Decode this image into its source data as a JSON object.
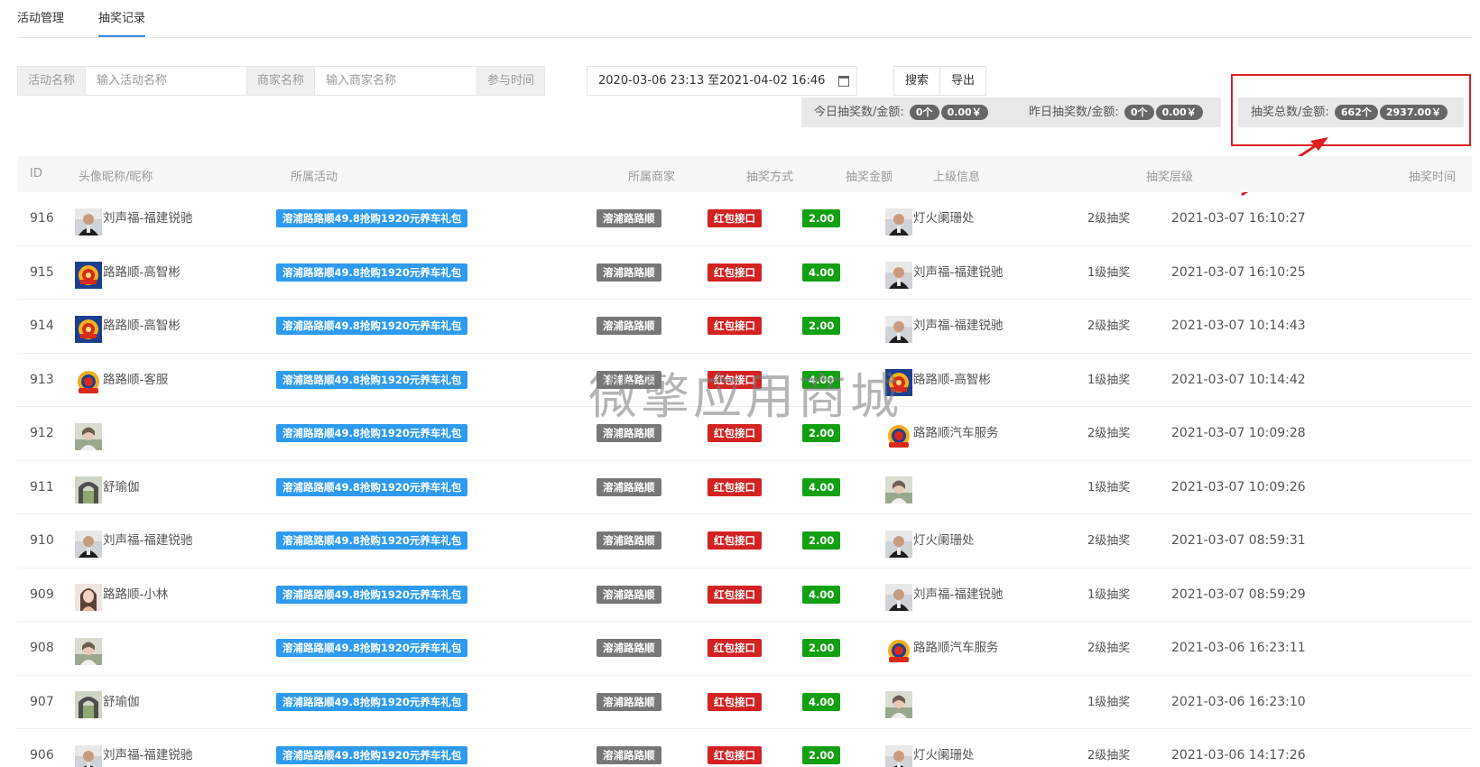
{
  "tabs": [
    {
      "label": "活动管理",
      "active": false
    },
    {
      "label": "抽奖记录",
      "active": true
    }
  ],
  "filters": {
    "activity_label": "活动名称",
    "activity_placeholder": "输入活动名称",
    "merchant_label": "商家名称",
    "merchant_placeholder": "输入商家名称",
    "time_label": "参与时间",
    "date_range": "2020-03-06 23:13 至2021-04-02 16:46",
    "search_button": "搜索",
    "export_button": "导出"
  },
  "stats": {
    "today": {
      "label": "今日抽奖数/金额:",
      "count": "0个",
      "amount": "0.00￥"
    },
    "yesterday": {
      "label": "昨日抽奖数/金额:",
      "count": "0个",
      "amount": "0.00￥"
    },
    "total": {
      "label": "抽奖总数/金额:",
      "count": "662个",
      "amount": "2937.00￥"
    }
  },
  "annotation_color": "#e02020",
  "table": {
    "headers": {
      "id": "ID",
      "user": "头像昵称/昵称",
      "activity": "所属活动",
      "merchant": "所属商家",
      "method": "抽奖方式",
      "amount": "抽奖金额",
      "parent": "上级信息",
      "level": "抽奖层级",
      "time": "抽奖时间"
    },
    "rows": [
      {
        "id": "916",
        "user": "刘声福-福建锐驰",
        "user_avatar": "dark",
        "activity": "溶浦路路顺49.8抢购1920元养车礼包",
        "merchant": "溶浦路路顺",
        "method": "红包接口",
        "amount": "2.00",
        "parent": "灯火阑珊处",
        "parent_avatar": "dark",
        "level": "2级抽奖",
        "time": "2021-03-07 16:10:27"
      },
      {
        "id": "915",
        "user": "路路顺-高智彬",
        "user_avatar": "badge",
        "activity": "溶浦路路顺49.8抢购1920元养车礼包",
        "merchant": "溶浦路路顺",
        "method": "红包接口",
        "amount": "4.00",
        "parent": "刘声福-福建锐驰",
        "parent_avatar": "dark",
        "level": "1级抽奖",
        "time": "2021-03-07 16:10:25"
      },
      {
        "id": "914",
        "user": "路路顺-高智彬",
        "user_avatar": "badge",
        "activity": "溶浦路路顺49.8抢购1920元养车礼包",
        "merchant": "溶浦路路顺",
        "method": "红包接口",
        "amount": "2.00",
        "parent": "刘声福-福建锐驰",
        "parent_avatar": "dark",
        "level": "2级抽奖",
        "time": "2021-03-07 10:14:43"
      },
      {
        "id": "913",
        "user": "路路顺-客服",
        "user_avatar": "gold",
        "activity": "溶浦路路顺49.8抢购1920元养车礼包",
        "merchant": "溶浦路路顺",
        "method": "红包接口",
        "amount": "4.00",
        "parent": "路路顺-高智彬",
        "parent_avatar": "badge",
        "level": "1级抽奖",
        "time": "2021-03-07 10:14:42"
      },
      {
        "id": "912",
        "user": "",
        "user_avatar": "photo",
        "activity": "溶浦路路顺49.8抢购1920元养车礼包",
        "merchant": "溶浦路路顺",
        "method": "红包接口",
        "amount": "2.00",
        "parent": "路路顺汽车服务",
        "parent_avatar": "gold",
        "level": "2级抽奖",
        "time": "2021-03-07 10:09:28"
      },
      {
        "id": "911",
        "user": "舒瑜伽",
        "user_avatar": "arch",
        "activity": "溶浦路路顺49.8抢购1920元养车礼包",
        "merchant": "溶浦路路顺",
        "method": "红包接口",
        "amount": "4.00",
        "parent": "",
        "parent_avatar": "photo",
        "level": "1级抽奖",
        "time": "2021-03-07 10:09:26"
      },
      {
        "id": "910",
        "user": "刘声福-福建锐驰",
        "user_avatar": "dark",
        "activity": "溶浦路路顺49.8抢购1920元养车礼包",
        "merchant": "溶浦路路顺",
        "method": "红包接口",
        "amount": "2.00",
        "parent": "灯火阑珊处",
        "parent_avatar": "dark",
        "level": "2级抽奖",
        "time": "2021-03-07 08:59:31"
      },
      {
        "id": "909",
        "user": "路路顺-小林",
        "user_avatar": "girl",
        "activity": "溶浦路路顺49.8抢购1920元养车礼包",
        "merchant": "溶浦路路顺",
        "method": "红包接口",
        "amount": "4.00",
        "parent": "刘声福-福建锐驰",
        "parent_avatar": "dark",
        "level": "1级抽奖",
        "time": "2021-03-07 08:59:29"
      },
      {
        "id": "908",
        "user": "",
        "user_avatar": "photo",
        "activity": "溶浦路路顺49.8抢购1920元养车礼包",
        "merchant": "溶浦路路顺",
        "method": "红包接口",
        "amount": "2.00",
        "parent": "路路顺汽车服务",
        "parent_avatar": "gold",
        "level": "2级抽奖",
        "time": "2021-03-06 16:23:11"
      },
      {
        "id": "907",
        "user": "舒瑜伽",
        "user_avatar": "arch",
        "activity": "溶浦路路顺49.8抢购1920元养车礼包",
        "merchant": "溶浦路路顺",
        "method": "红包接口",
        "amount": "4.00",
        "parent": "",
        "parent_avatar": "photo",
        "level": "1级抽奖",
        "time": "2021-03-06 16:23:10"
      },
      {
        "id": "906",
        "user": "刘声福-福建锐驰",
        "user_avatar": "dark",
        "activity": "溶浦路路顺49.8抢购1920元养车礼包",
        "merchant": "溶浦路路顺",
        "method": "红包接口",
        "amount": "2.00",
        "parent": "灯火阑珊处",
        "parent_avatar": "dark",
        "level": "2级抽奖",
        "time": "2021-03-06 14:17:26"
      }
    ]
  },
  "watermark": "微擎应用商城"
}
